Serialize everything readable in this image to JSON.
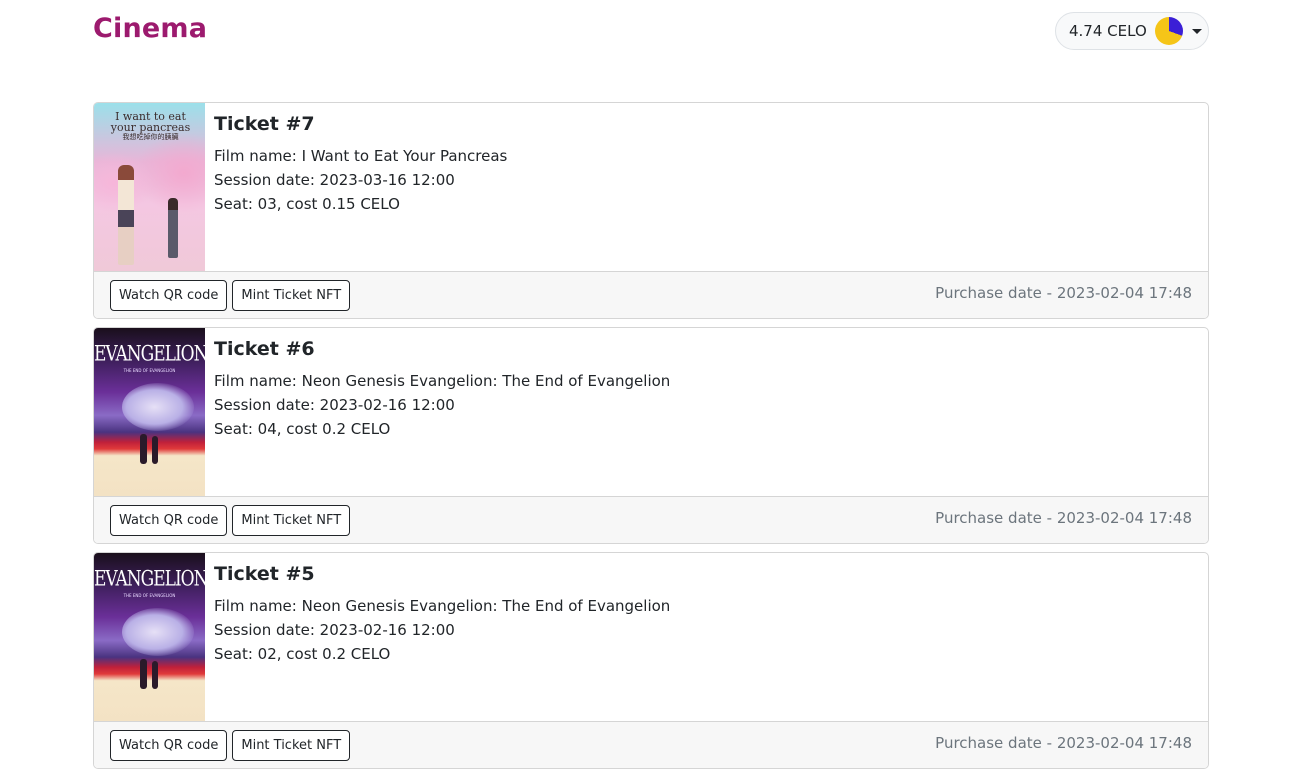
{
  "header": {
    "brand": "Cinema",
    "wallet": {
      "balance": "4.74 CELO",
      "avatar_icon": "wallet-avatar-icon",
      "caret_icon": "chevron-down-icon"
    }
  },
  "colors": {
    "brand": "#9c1a6e",
    "muted": "#6c757d",
    "footer_bg": "#f7f7f7"
  },
  "tickets": [
    {
      "title": "Ticket #7",
      "poster": {
        "kind": "pancreas",
        "text_line1": "I want to eat",
        "text_line2": "your pancreas",
        "text_line3": "我想吃掉你的胰臟"
      },
      "film": "Film name: I Want to Eat Your Pancreas",
      "session": "Session date: 2023-03-16 12:00",
      "seat": "Seat: 03, cost 0.15 CELO",
      "qr_label": "Watch QR code",
      "mint_label": "Mint Ticket NFT",
      "purchase": "Purchase date - 2023-02-04 17:48"
    },
    {
      "title": "Ticket #6",
      "poster": {
        "kind": "eva",
        "text_line1": "EVANGELION",
        "text_line2": "THE END OF EVANGELION"
      },
      "film": "Film name: Neon Genesis Evangelion: The End of Evangelion",
      "session": "Session date: 2023-02-16 12:00",
      "seat": "Seat: 04, cost 0.2 CELO",
      "qr_label": "Watch QR code",
      "mint_label": "Mint Ticket NFT",
      "purchase": "Purchase date - 2023-02-04 17:48"
    },
    {
      "title": "Ticket #5",
      "poster": {
        "kind": "eva",
        "text_line1": "EVANGELION",
        "text_line2": "THE END OF EVANGELION"
      },
      "film": "Film name: Neon Genesis Evangelion: The End of Evangelion",
      "session": "Session date: 2023-02-16 12:00",
      "seat": "Seat: 02, cost 0.2 CELO",
      "qr_label": "Watch QR code",
      "mint_label": "Mint Ticket NFT",
      "purchase": "Purchase date - 2023-02-04 17:48"
    }
  ]
}
